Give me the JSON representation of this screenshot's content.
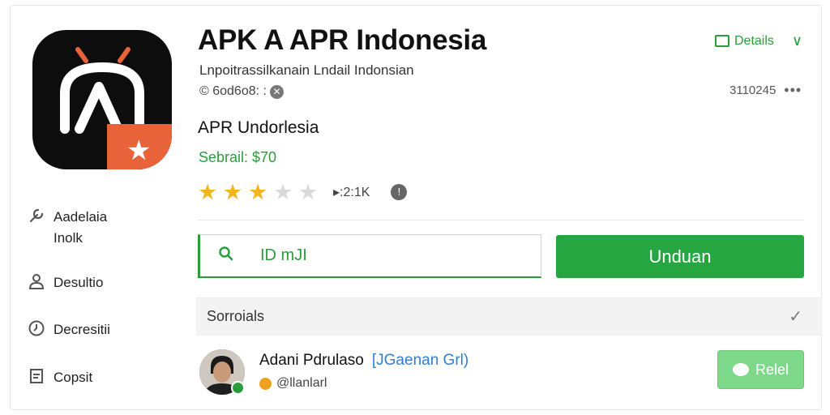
{
  "app": {
    "title": "APK A APR Indonesia",
    "subtitle": "Lnpoitrassilkanain Lndail Indonsian",
    "meta": "© 6od6o8: :",
    "name": "APR Undorlesia",
    "price": "Sebrail: $70",
    "rating_count": "▸:2:1K",
    "code": "3110245",
    "stars": {
      "filled": 3,
      "total": 5
    }
  },
  "header": {
    "details_label": "Details"
  },
  "sidebar": {
    "items": [
      {
        "label": "Aadelaia Inolk",
        "icon": "wrench-icon"
      },
      {
        "label": "Desultio",
        "icon": "user-icon"
      },
      {
        "label": "Decresitii",
        "icon": "clock-icon"
      },
      {
        "label": "Copsit",
        "icon": "document-icon"
      }
    ]
  },
  "search": {
    "value": "ID mJI"
  },
  "actions": {
    "download_label": "Unduan",
    "reply_label": "Relel"
  },
  "section": {
    "label": "Sorroials"
  },
  "author": {
    "name": "Adani Pdrulaso",
    "tag": "[JGaenan Grl)",
    "handle": "@llanlarl"
  },
  "colors": {
    "accent": "#25a641",
    "star": "#f4b51c",
    "icon_badge": "#e8623a"
  }
}
